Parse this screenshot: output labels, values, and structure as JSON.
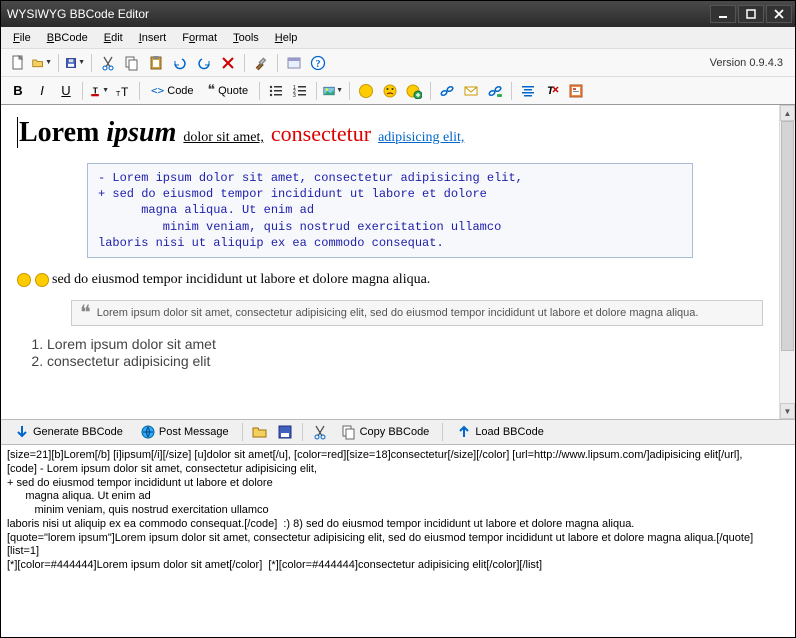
{
  "window": {
    "title": "WYSIWYG BBCode Editor"
  },
  "menubar": [
    "File",
    "BBCode",
    "Edit",
    "Insert",
    "Format",
    "Tools",
    "Help"
  ],
  "version": "Version 0.9.4.3",
  "toolbar2": {
    "bold": "B",
    "italic": "I",
    "underline": "U",
    "code": "Code",
    "quote": "Quote"
  },
  "content": {
    "lorem": "Lorem",
    "ipsum": "ipsum",
    "dolor": "dolor sit amet,",
    "consec": "consectetur",
    "adip": "adipisicing elit,",
    "code": "- Lorem ipsum dolor sit amet, consectetur adipisicing elit,\n+ sed do eiusmod tempor incididunt ut labore et dolore\n      magna aliqua. Ut enim ad\n         minim veniam, quis nostrud exercitation ullamco\nlaboris nisi ut aliquip ex ea commodo consequat.",
    "emoji_text": "sed do eiusmod tempor incididunt ut labore et dolore magna aliqua.",
    "quote": "Lorem ipsum dolor sit amet, consectetur adipisicing elit, sed do eiusmod tempor incididunt ut labore et dolore magna aliqua.",
    "li1": "Lorem ipsum dolor sit amet",
    "li2": "consectetur adipisicing elit"
  },
  "bottom": {
    "generate": "Generate BBCode",
    "post": "Post Message",
    "copy": "Copy BBCode",
    "load": "Load BBCode"
  },
  "output": "[size=21][b]Lorem[/b] [i]ipsum[/i][/size] [u]dolor sit amet[/u], [color=red][size=18]consectetur[/size][/color] [url=http://www.lipsum.com/]adipisicing elit[/url],\n[code] - Lorem ipsum dolor sit amet, consectetur adipisicing elit,\n+ sed do eiusmod tempor incididunt ut labore et dolore\n      magna aliqua. Ut enim ad\n         minim veniam, quis nostrud exercitation ullamco\nlaboris nisi ut aliquip ex ea commodo consequat.[/code]  :) 8) sed do eiusmod tempor incididunt ut labore et dolore magna aliqua.\n[quote=\"lorem ipsum\"]Lorem ipsum dolor sit amet, consectetur adipisicing elit, sed do eiusmod tempor incididunt ut labore et dolore magna aliqua.[/quote]  [list=1]\n[*][color=#444444]Lorem ipsum dolor sit amet[/color]  [*][color=#444444]consectetur adipisicing elit[/color][/list]"
}
